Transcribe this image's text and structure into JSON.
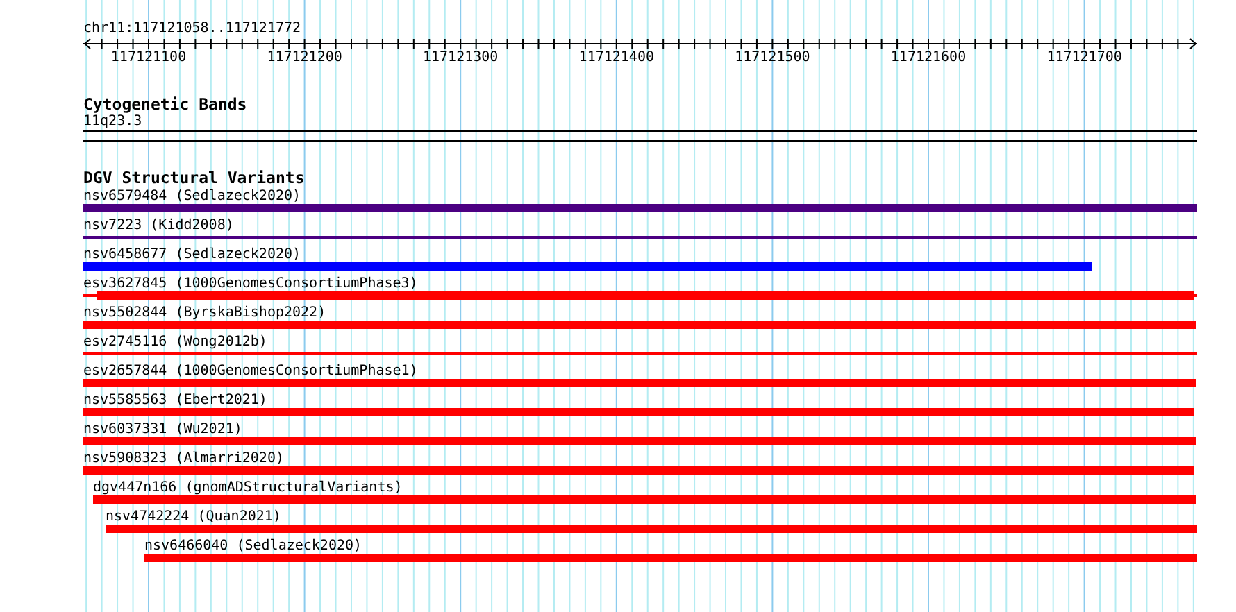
{
  "locus": "chr11:117121058..117121772",
  "ruler": {
    "ticks": [
      "117121100",
      "117121200",
      "117121300",
      "117121400",
      "117121500",
      "117121600",
      "117121700"
    ]
  },
  "tracks": [
    {
      "title": "Cytogenetic Bands",
      "kind": "bands",
      "items": [
        {
          "label": "11q23.3"
        }
      ]
    },
    {
      "title": "DGV Structural Variants",
      "kind": "variants",
      "items": [
        {
          "label": "nsv6579484 (Sedlazeck2020)",
          "kind": "thick",
          "color": "#4b0082"
        },
        {
          "label": "nsv7223 (Kidd2008)",
          "kind": "thin",
          "color": "#4b0082"
        },
        {
          "label": "nsv6458677 (Sedlazeck2020)",
          "kind": "thick",
          "color": "#0000ff"
        },
        {
          "label": "esv3627845 (1000GenomesConsortiumPhase3)",
          "kind": "both",
          "color": "#ff0000"
        },
        {
          "label": "nsv5502844 (ByrskaBishop2022)",
          "kind": "thick",
          "color": "#ff0000"
        },
        {
          "label": "esv2745116 (Wong2012b)",
          "kind": "thin",
          "color": "#ff0000"
        },
        {
          "label": "esv2657844 (1000GenomesConsortiumPhase1)",
          "kind": "thick",
          "color": "#ff0000"
        },
        {
          "label": "nsv5585563 (Ebert2021)",
          "kind": "thick",
          "color": "#ff0000"
        },
        {
          "label": "nsv6037331 (Wu2021)",
          "kind": "thick",
          "color": "#ff0000"
        },
        {
          "label": "nsv5908323 (Almarri2020)",
          "kind": "thick",
          "color": "#ff0000"
        },
        {
          "label": "dgv447n166 (gnomADStructuralVariants)",
          "kind": "thick",
          "color": "#ff0000"
        },
        {
          "label": "nsv4742224 (Quan2021)",
          "kind": "thick",
          "color": "#ff0000"
        },
        {
          "label": "nsv6466040 (Sedlazeck2020)",
          "kind": "thick",
          "color": "#ff0000"
        }
      ]
    }
  ]
}
